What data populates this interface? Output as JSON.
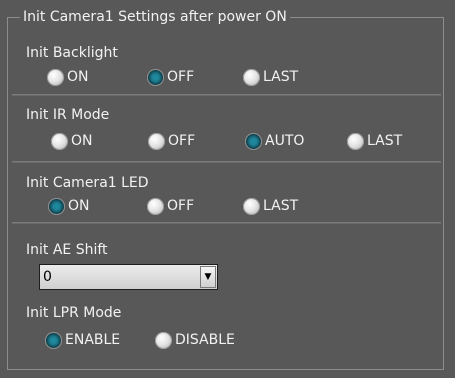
{
  "group": {
    "title": "Init Camera1 Settings after power ON"
  },
  "backlight": {
    "label": "Init Backlight",
    "options": [
      "ON",
      "OFF",
      "LAST"
    ],
    "selected": "OFF"
  },
  "ir_mode": {
    "label": "Init IR Mode",
    "options": [
      "ON",
      "OFF",
      "AUTO",
      "LAST"
    ],
    "selected": "AUTO"
  },
  "led": {
    "label": "Init Camera1 LED",
    "options": [
      "ON",
      "OFF",
      "LAST"
    ],
    "selected": "ON"
  },
  "ae_shift": {
    "label": "Init AE Shift",
    "value": "0",
    "dropdown_icon": "triangle-down"
  },
  "lpr_mode": {
    "label": "Init LPR Mode",
    "options": [
      "ENABLE",
      "DISABLE"
    ],
    "selected": "ENABLE"
  },
  "colors": {
    "background": "#585858",
    "selected_radio": "#1f7f93",
    "text": "#f2f2f2"
  }
}
